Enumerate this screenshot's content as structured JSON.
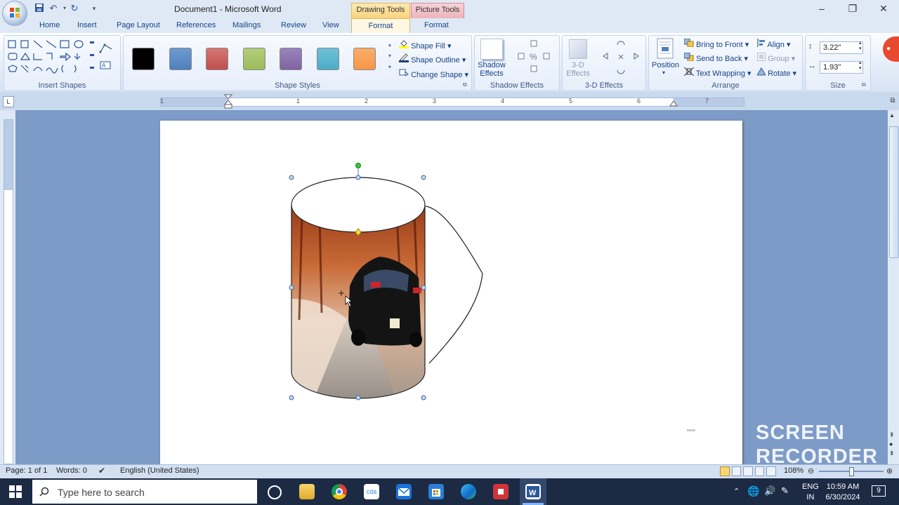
{
  "title_bar": {
    "document_title": "Document1 - Microsoft Word",
    "contextual_tabs": [
      "Drawing Tools",
      "Picture Tools"
    ]
  },
  "tabs": {
    "home": "Home",
    "insert": "Insert",
    "page_layout": "Page Layout",
    "references": "References",
    "mailings": "Mailings",
    "review": "Review",
    "view": "View",
    "format_drawing": "Format",
    "format_picture": "Format"
  },
  "ribbon": {
    "insert_shapes_label": "Insert Shapes",
    "shape_styles_label": "Shape Styles",
    "shape_fill": "Shape Fill",
    "shape_outline": "Shape Outline",
    "change_shape": "Change Shape",
    "shadow_effects_label": "Shadow Effects",
    "shadow_effects_button": "Shadow Effects",
    "three_d_effects_label": "3-D Effects",
    "three_d_effects_button": "3-D Effects",
    "arrange_label": "Arrange",
    "position": "Position",
    "bring_to_front": "Bring to Front",
    "send_to_back": "Send to Back",
    "text_wrapping": "Text Wrapping",
    "align": "Align",
    "group": "Group",
    "rotate": "Rotate",
    "size_label": "Size",
    "height_value": "3.22\"",
    "width_value": "1.93\"",
    "style_swatches": [
      "#000000",
      "#4f81bd",
      "#c0504d",
      "#9bbb59",
      "#8064a2",
      "#4bacc6",
      "#f79646"
    ]
  },
  "ruler": {
    "marks": [
      "1",
      "1",
      "2",
      "3",
      "4",
      "5",
      "6",
      "7"
    ]
  },
  "status_bar": {
    "page": "Page: 1 of 1",
    "words": "Words: 0",
    "language": "English (United States)",
    "zoom": "108%"
  },
  "taskbar": {
    "search_placeholder": "Type here to search",
    "lang_top": "ENG",
    "lang_bottom": "IN",
    "time": "10:59 AM",
    "date": "6/30/2024",
    "notification_count": "9"
  },
  "watermark": {
    "line1": "SCREEN",
    "line2": "RECORDER"
  }
}
